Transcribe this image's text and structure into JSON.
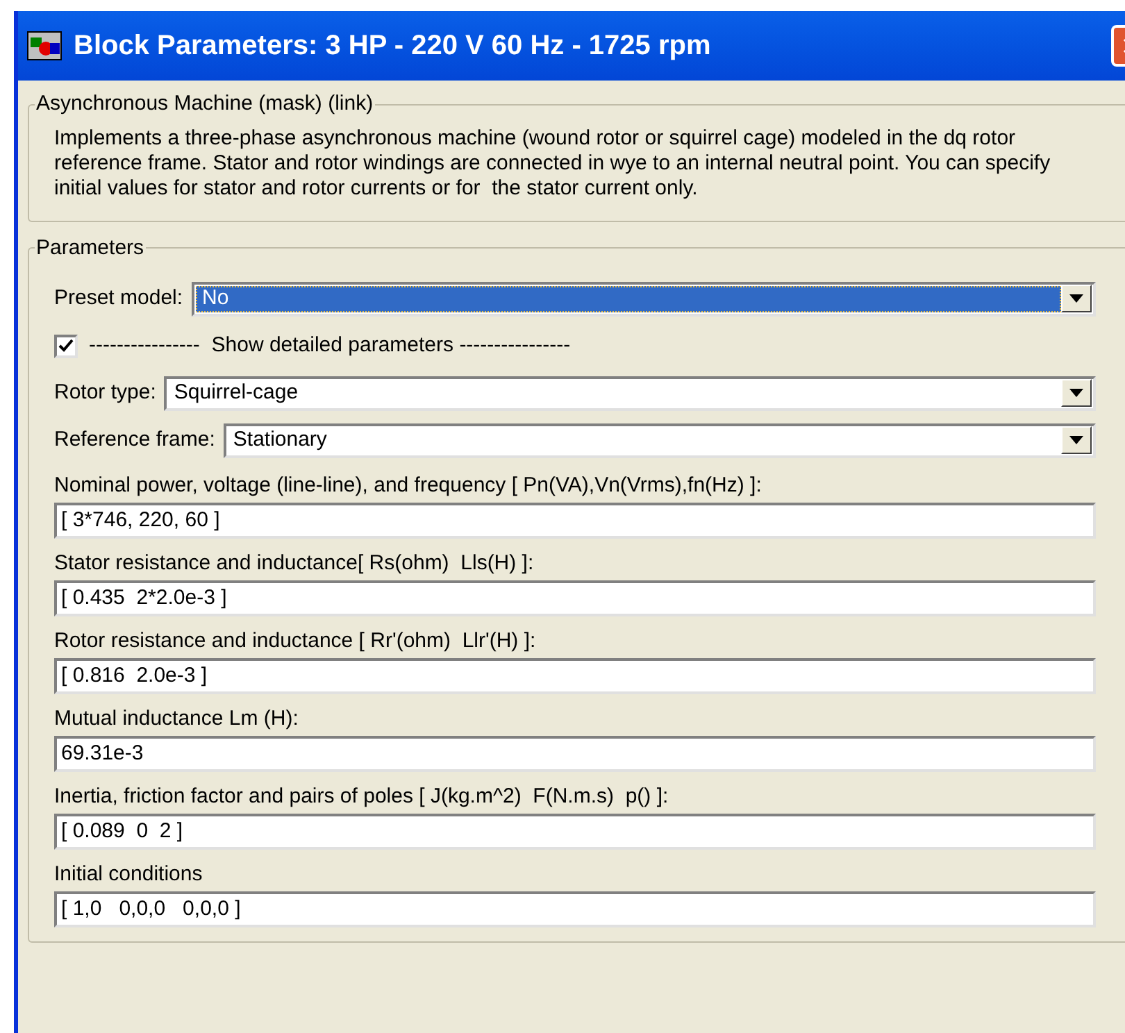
{
  "window": {
    "title": "Block Parameters: 3 HP - 220 V 60 Hz - 1725 rpm"
  },
  "description_group": {
    "title": "Asynchronous Machine (mask) (link)",
    "text": "Implements a three-phase asynchronous machine (wound rotor or squirrel cage) modeled in the dq rotor reference frame. Stator and rotor windings are connected in wye to an internal neutral point. You can specify initial values for stator and rotor currents or for  the stator current only."
  },
  "parameters_group": {
    "title": "Parameters",
    "fields": [
      {
        "kind": "dropdown",
        "label": "Preset model:",
        "value": "No",
        "highlighted": true
      },
      {
        "kind": "checkbox",
        "label": "----------------  Show detailed parameters ----------------",
        "checked": true
      },
      {
        "kind": "dropdown",
        "label": "Rotor type:",
        "value": "Squirrel-cage",
        "highlighted": false
      },
      {
        "kind": "dropdown",
        "label": "Reference frame:",
        "value": "Stationary",
        "highlighted": false
      },
      {
        "kind": "text",
        "label": "Nominal power, voltage (line-line), and frequency [ Pn(VA),Vn(Vrms),fn(Hz) ]:",
        "value": "[ 3*746, 220, 60 ]"
      },
      {
        "kind": "text",
        "label": "Stator resistance and inductance[ Rs(ohm)  Lls(H) ]:",
        "value": "[ 0.435  2*2.0e-3 ]"
      },
      {
        "kind": "text",
        "label": "Rotor resistance and inductance [ Rr'(ohm)  Llr'(H) ]:",
        "value": "[ 0.816  2.0e-3 ]"
      },
      {
        "kind": "text",
        "label": "Mutual inductance Lm (H):",
        "value": "69.31e-3"
      },
      {
        "kind": "text",
        "label": "Inertia, friction factor and pairs of poles [ J(kg.m^2)  F(N.m.s)  p() ]:",
        "value": "[ 0.089  0  2 ]"
      },
      {
        "kind": "text",
        "label": "Initial conditions",
        "value": "[ 1,0   0,0,0   0,0,0 ]"
      }
    ]
  }
}
